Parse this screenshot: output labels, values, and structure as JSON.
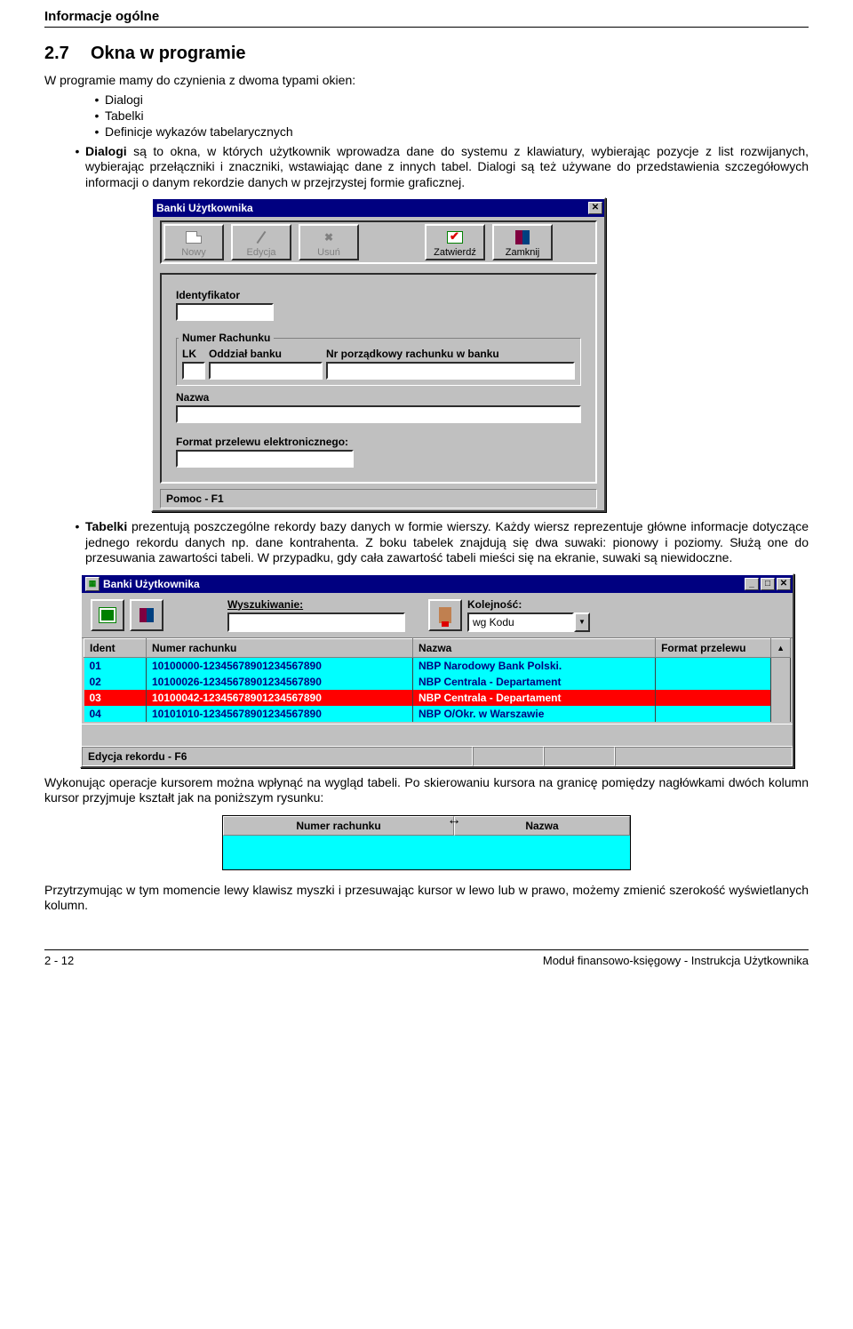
{
  "doc_header": "Informacje ogólne",
  "section": {
    "num": "2.7",
    "title": "Okna w programie"
  },
  "intro": "W programie mamy do czynienia z dwoma typami okien:",
  "intro_items": [
    "Dialogi",
    "Tabelki",
    "Definicje wykazów tabelarycznych"
  ],
  "para_dialogi_lead": "Dialogi",
  "para_dialogi": " są to okna, w których użytkownik wprowadza dane do systemu z klawiatury, wybierając pozycje z list rozwijanych, wybierając przełączniki i znaczniki, wstawiając dane z innych tabel. Dialogi są też używane do przedstawienia szczegółowych informacji o danym rekordzie danych w przejrzystej formie graficznej.",
  "dialog": {
    "title": "Banki Użytkownika",
    "toolbar": {
      "nowy": "Nowy",
      "edycja": "Edycja",
      "usun": "Usuń",
      "zatwierdz": "Zatwierdź",
      "zamknij": "Zamknij"
    },
    "labels": {
      "identyfikator": "Identyfikator",
      "numer_rachunku": "Numer Rachunku",
      "lk": "LK",
      "oddzial": "Oddział banku",
      "nr_porz": "Nr porządkowy rachunku w banku",
      "nazwa": "Nazwa",
      "format": "Format przelewu elektronicznego:"
    },
    "status": "Pomoc - F1"
  },
  "para_tabelki_lead": "Tabelki",
  "para_tabelki": " prezentują poszczególne rekordy bazy danych w formie wierszy. Każdy wiersz reprezentuje główne informacje dotyczące jednego rekordu danych np. dane kontrahenta. Z boku tabelek znajdują się dwa suwaki: pionowy i poziomy. Służą one do przesuwania zawartości tabeli. W przypadku, gdy cała zawartość tabeli mieści się na ekranie, suwaki są niewidoczne.",
  "tablewin": {
    "title": "Banki Użytkownika",
    "search_label": "Wyszukiwanie:",
    "order_label": "Kolejność:",
    "order_value": "wg Kodu",
    "columns": [
      "Ident",
      "Numer rachunku",
      "Nazwa",
      "Format przelewu"
    ],
    "rows": [
      {
        "ident": "01",
        "nr": "10100000-1234567890|1234567890",
        "nazwa": "NBP Narodowy Bank Polski.",
        "sel": false
      },
      {
        "ident": "02",
        "nr": "10100026-1234567890|1234567890",
        "nazwa": "NBP Centrala - Departament",
        "sel": false
      },
      {
        "ident": "03",
        "nr": "10100042-1234567890|1234567890",
        "nazwa": "NBP Centrala - Departament",
        "sel": true
      },
      {
        "ident": "04",
        "nr": "10101010-1234567890|1234567890",
        "nazwa": "NBP O/Okr. w Warszawie",
        "sel": false
      }
    ],
    "status": "Edycja rekordu - F6"
  },
  "para_after_table": "Wykonując operacje kursorem można wpłynąć na wygląd tabeli. Po skierowaniu kursora na granicę pomiędzy nagłówkami dwóch kolumn kursor przyjmuje kształt jak na poniższym rysunku:",
  "hdr_drag": {
    "col1": "Numer rachunku",
    "col2": "Nazwa"
  },
  "para_last": "Przytrzymując w tym momencie lewy klawisz myszki i przesuwając kursor w lewo lub w prawo, możemy zmienić szerokość wyświetlanych kolumn.",
  "footer": {
    "left": "2 - 12",
    "right": "Moduł finansowo-księgowy - Instrukcja Użytkownika"
  }
}
